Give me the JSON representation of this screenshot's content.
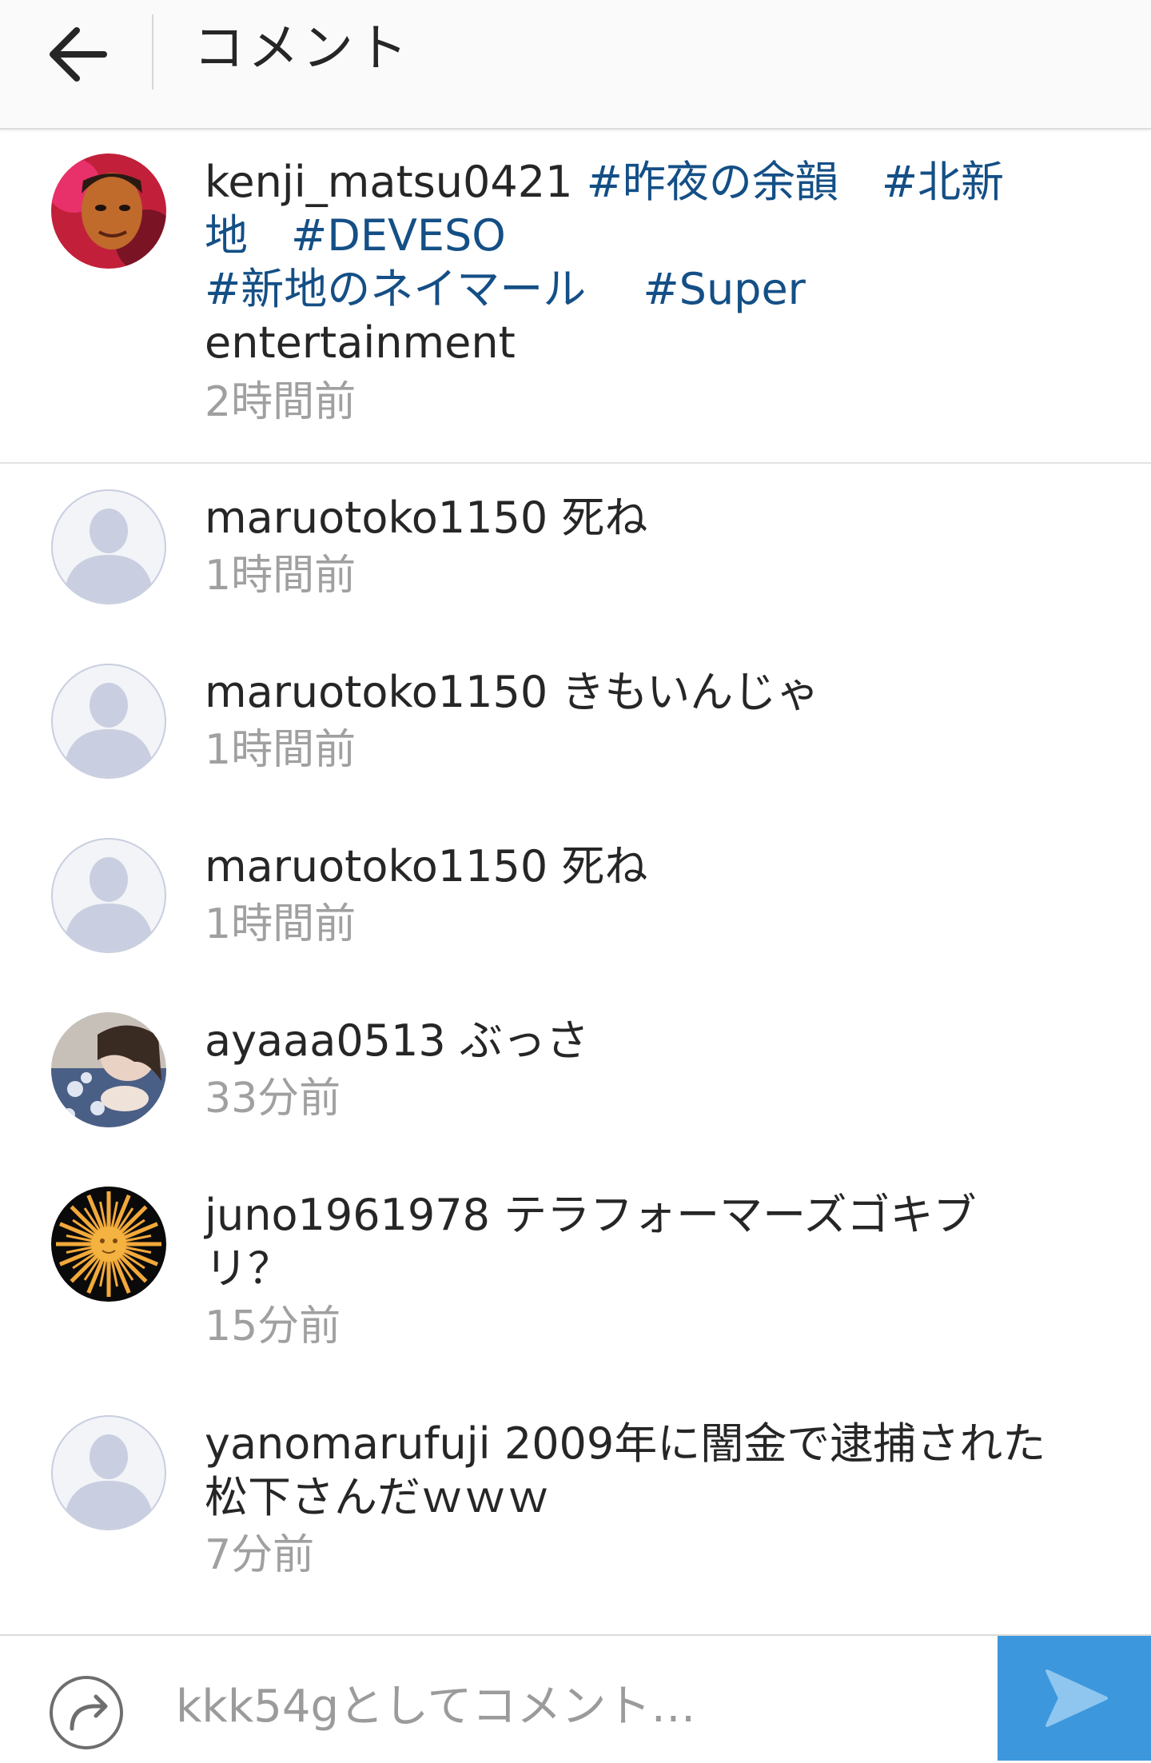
{
  "header": {
    "title": "コメント",
    "back_icon": "arrow-left-icon"
  },
  "caption": {
    "username": "kenji_matsu0421",
    "lines": [
      [
        {
          "text": "#昨夜の余韻",
          "tag": true
        },
        {
          "text": "　",
          "tag": false
        },
        {
          "text": "#北新",
          "tag": true
        }
      ],
      [
        {
          "text": "地",
          "tag": true
        },
        {
          "text": "　",
          "tag": false
        },
        {
          "text": "#DEVESO",
          "tag": true
        }
      ],
      [
        {
          "text": "#新地のネイマール",
          "tag": true
        },
        {
          "text": "　 ",
          "tag": false
        },
        {
          "text": "#Super",
          "tag": true
        }
      ],
      [
        {
          "text": "entertainment",
          "tag": false
        }
      ]
    ],
    "time": "2時間前"
  },
  "comments": [
    {
      "username": "maruotoko1150",
      "lines": [
        "死ね"
      ],
      "time": "1時間前",
      "avatar": "default-avatar-icon"
    },
    {
      "username": "maruotoko1150",
      "lines": [
        "きもいんじゃ"
      ],
      "time": "1時間前",
      "avatar": "default-avatar-icon"
    },
    {
      "username": "maruotoko1150",
      "lines": [
        "死ね"
      ],
      "time": "1時間前",
      "avatar": "default-avatar-icon"
    },
    {
      "username": "ayaaa0513",
      "lines": [
        "ぶっさ"
      ],
      "time": "33分前",
      "avatar": "photo-avatar"
    },
    {
      "username": "juno1961978",
      "lines": [
        "テラフォーマーズゴキブ",
        "リ？"
      ],
      "time": "15分前",
      "avatar": "sun-avatar"
    },
    {
      "username": "yanomarufuji",
      "lines": [
        "2009年に闇金で逮捕された",
        "松下さんだｗｗｗ"
      ],
      "time": "7分前",
      "avatar": "default-avatar-icon"
    }
  ],
  "composer": {
    "placeholder": "kkk54gとしてコメント…",
    "reply_icon": "reply-arrow-icon",
    "send_icon": "send-icon"
  },
  "colors": {
    "hashtag": "#144f86",
    "timestamp": "#a0a0a0",
    "send_button": "#3c97dd",
    "default_avatar": "#c9cfe0"
  }
}
